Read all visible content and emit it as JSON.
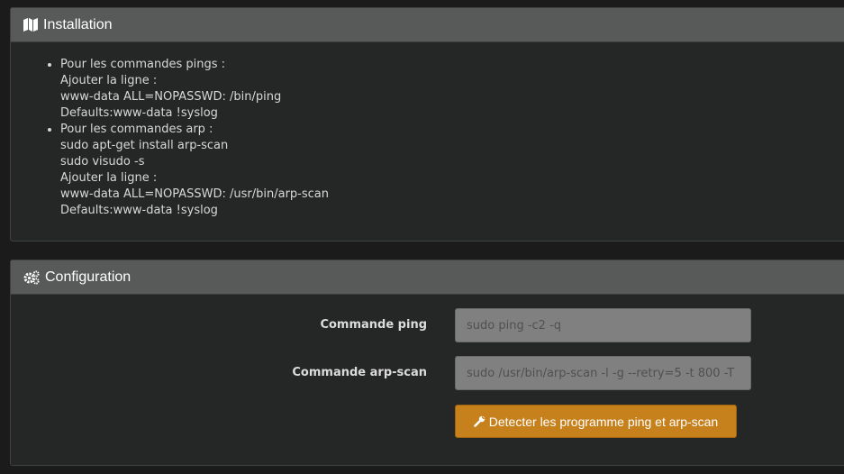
{
  "installation": {
    "title": "Installation",
    "icon": "map-icon",
    "items": [
      {
        "lines": [
          "Pour les commandes pings :",
          "Ajouter la ligne :",
          "www-data ALL=NOPASSWD: /bin/ping",
          "Defaults:www-data !syslog"
        ]
      },
      {
        "lines": [
          "Pour les commandes arp :",
          "sudo apt-get install arp-scan",
          "sudo visudo -s",
          "Ajouter la ligne :",
          "www-data ALL=NOPASSWD: /usr/bin/arp-scan",
          "Defaults:www-data !syslog"
        ]
      }
    ]
  },
  "configuration": {
    "title": "Configuration",
    "icon": "gears-icon",
    "ping_label": "Commande ping",
    "ping_placeholder": "sudo ping -c2 -q",
    "arp_label": "Commande arp-scan",
    "arp_placeholder": "sudo /usr/bin/arp-scan -l -g --retry=5 -t 800 -T",
    "detect_button_label": "Detecter les programme ping et arp-scan",
    "detect_button_icon": "wrench-icon",
    "accent_color": "#c6801c"
  }
}
